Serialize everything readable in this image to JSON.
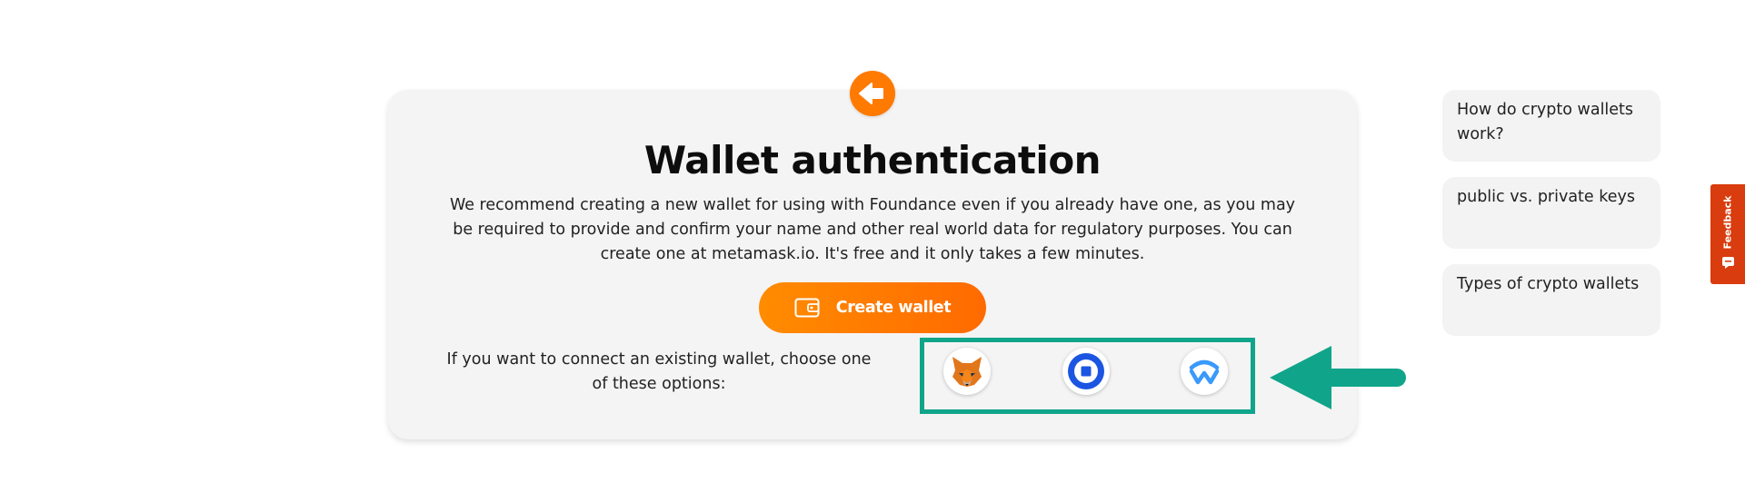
{
  "header": {
    "back_icon": "arrow-left-icon"
  },
  "main": {
    "title": "Wallet authentication",
    "description": "We recommend creating a new wallet for using with Foundance even if you already have one, as you may be required to provide and confirm your name and other real world data for regulatory purposes. You can create one at metamask.io. It's free and it only takes a few minutes.",
    "create_button": {
      "label": "Create wallet",
      "icon": "wallet-icon"
    },
    "connect_text": "If you want to connect an existing wallet, choose one of these options:",
    "wallet_options": [
      {
        "icon": "metamask-fox-icon"
      },
      {
        "icon": "coinbase-wallet-icon"
      },
      {
        "icon": "walletconnect-icon"
      }
    ],
    "highlight_arrow_icon": "arrow-left-icon"
  },
  "help_panel": {
    "items": [
      {
        "label": "How do crypto wallets work?"
      },
      {
        "label": "public vs. private keys"
      },
      {
        "label": "Types of crypto wallets"
      }
    ]
  },
  "feedback": {
    "label": "Feedback",
    "icon": "chat-bubble-icon"
  },
  "colors": {
    "accent_orange": "#ff7a00",
    "highlight_green": "#10a58a",
    "card_bg": "#f5f4f4",
    "feedback_red": "#d93c0e"
  }
}
